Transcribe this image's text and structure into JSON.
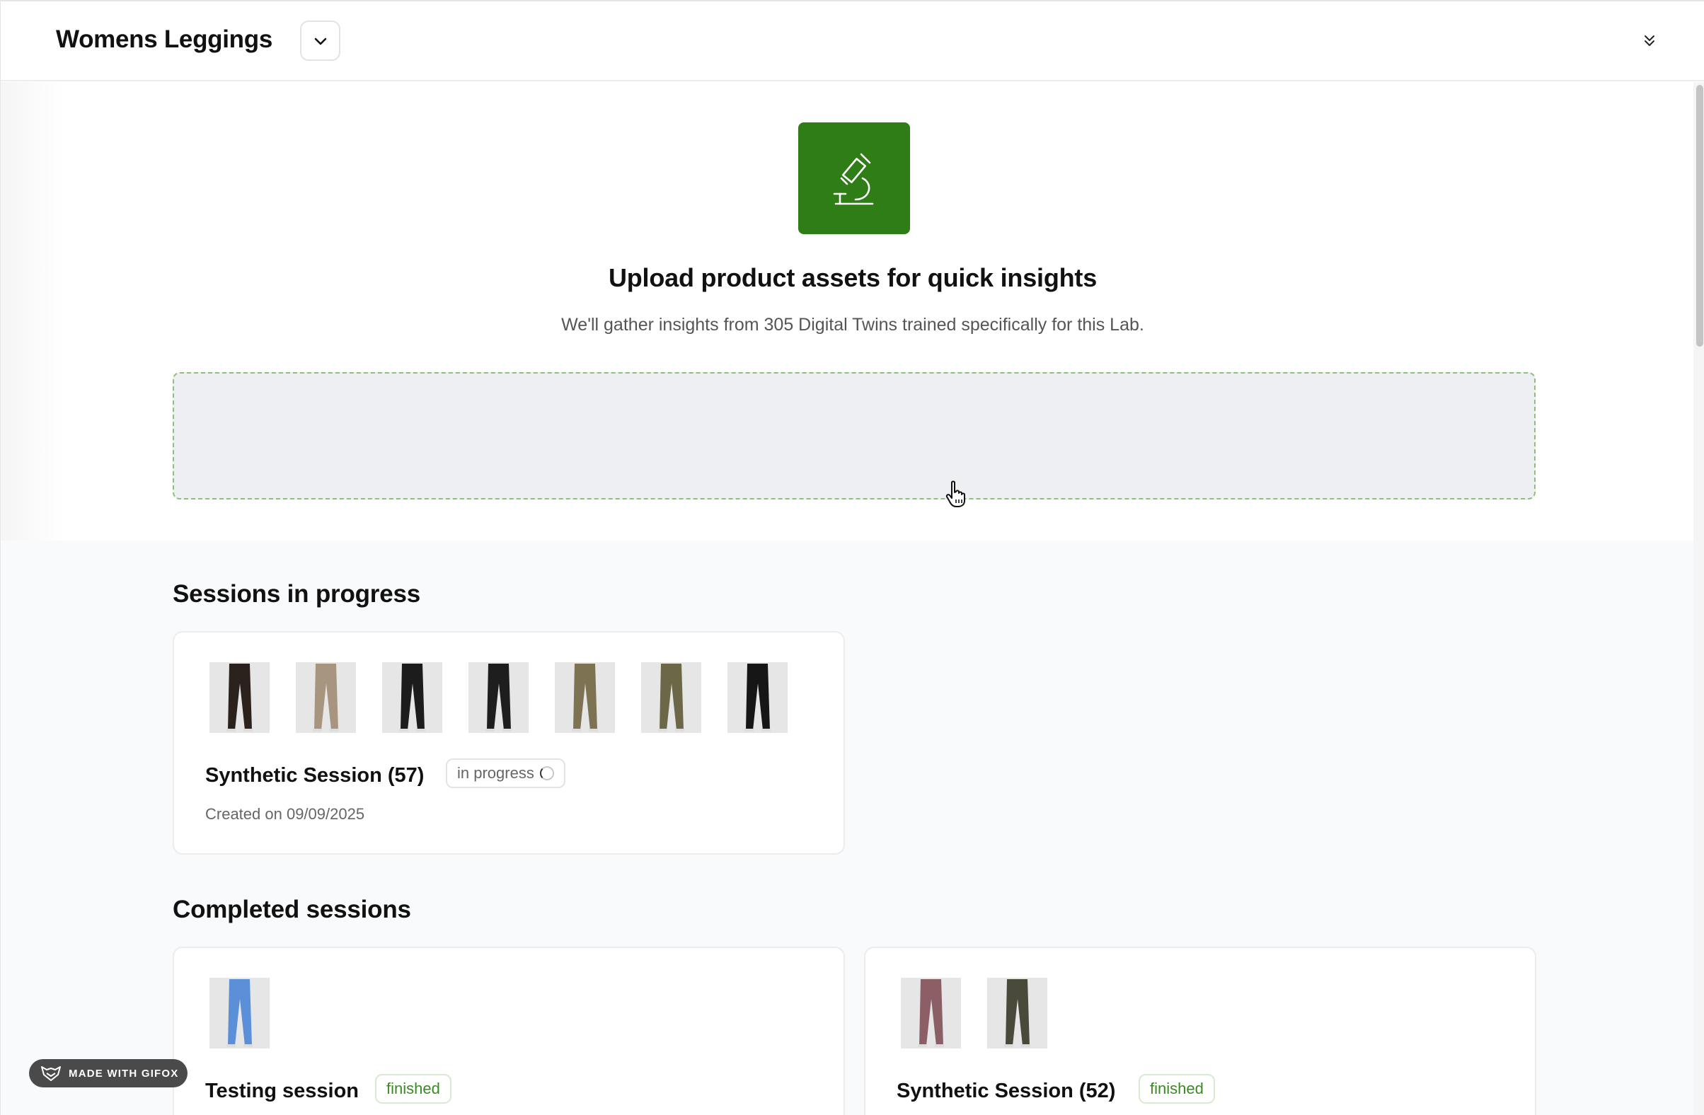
{
  "header": {
    "title": "Womens Leggings",
    "dropdown_icon": "chevron-down-icon",
    "collapse_icon": "double-chevron-down-icon"
  },
  "hero": {
    "icon": "microscope-icon",
    "icon_bg": "#2e7d16",
    "title": "Upload product assets for quick insights",
    "subtitle": "We'll gather insights from 305 Digital Twins trained specifically for this Lab."
  },
  "in_progress": {
    "title": "Sessions in progress",
    "sessions": [
      {
        "name": "Synthetic Session (57)",
        "status": "in progress",
        "created": "Created on 09/09/2025",
        "thumbnails": [
          "#2b211d",
          "#a89580",
          "#1c1c1c",
          "#1e1e1e",
          "#7d7352",
          "#6b6747",
          "#161616"
        ]
      }
    ]
  },
  "completed": {
    "title": "Completed sessions",
    "sessions": [
      {
        "name": "Testing session",
        "status": "finished",
        "thumbnails": [
          "#5b8fd8"
        ]
      },
      {
        "name": "Synthetic Session (52)",
        "status": "finished",
        "thumbnails": [
          "#8c5f67",
          "#4a4a3a"
        ]
      }
    ]
  },
  "watermark": {
    "label": "MADE WITH GIFOX"
  },
  "colors": {
    "finished": "#3a8a23",
    "dropzone_border": "#8fbf7d"
  }
}
